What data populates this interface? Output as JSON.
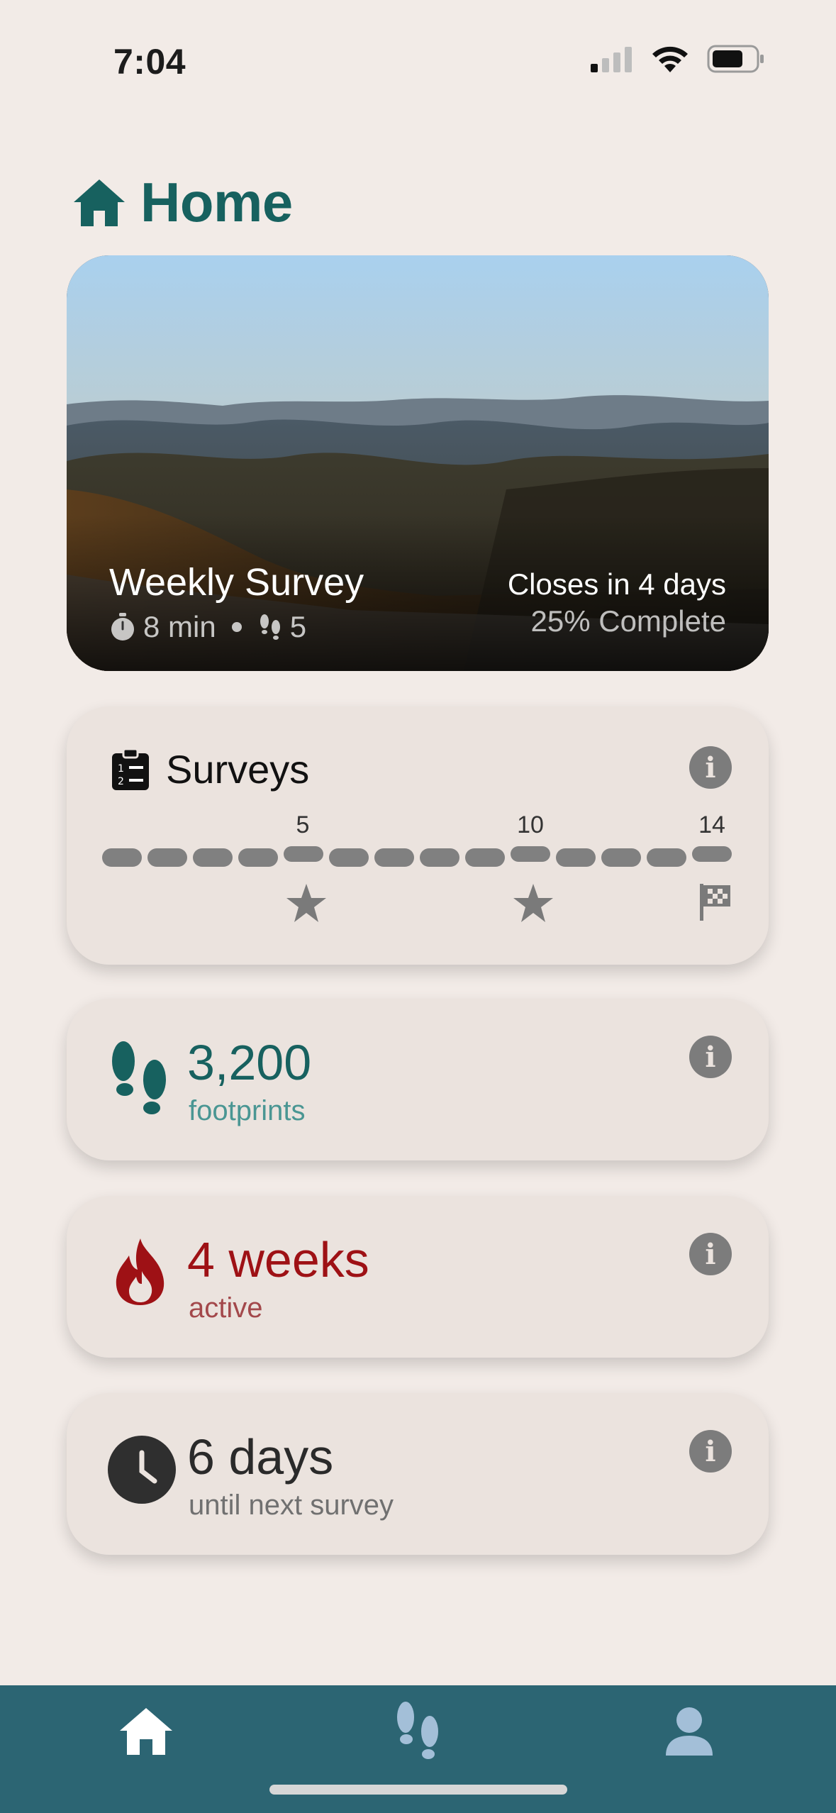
{
  "status_bar": {
    "time": "7:04"
  },
  "header": {
    "title": "Home"
  },
  "hero": {
    "title": "Weekly Survey",
    "duration": "8 min",
    "steps": "5",
    "closes": "Closes in 4 days",
    "progress": "25% Complete"
  },
  "surveys_card": {
    "title": "Surveys",
    "total_segments": 14,
    "milestones": [
      "5",
      "10",
      "14"
    ]
  },
  "footprints_card": {
    "value": "3,200",
    "label": "footprints"
  },
  "streak_card": {
    "value": "4 weeks",
    "label": "active"
  },
  "next_survey_card": {
    "value": "6 days",
    "label": "until next survey"
  },
  "nav": {
    "items": [
      "home-icon",
      "footprints-icon",
      "profile-icon"
    ]
  },
  "colors": {
    "accent_teal": "#17615f",
    "streak_red": "#9e1115",
    "nav_bg": "#2c6573"
  }
}
